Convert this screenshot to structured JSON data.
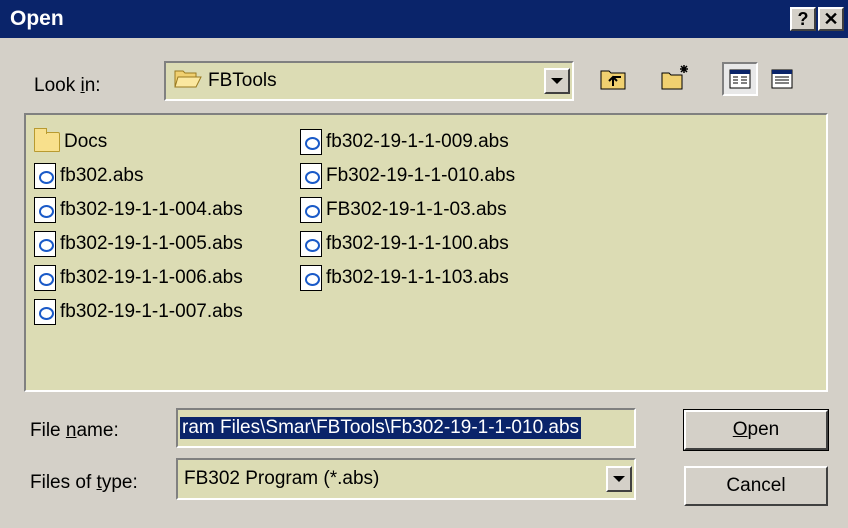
{
  "dialog": {
    "title": "Open",
    "help_btn": "?",
    "close_btn": "✕"
  },
  "look_in": {
    "label_pre": "Look ",
    "label_u": "i",
    "label_post": "n:",
    "value": "FBTools"
  },
  "files": {
    "col1": [
      "Docs",
      "fb302.abs",
      "fb302-19-1-1-004.abs",
      "fb302-19-1-1-005.abs",
      "fb302-19-1-1-006.abs",
      "fb302-19-1-1-007.abs"
    ],
    "col2": [
      "fb302-19-1-1-009.abs",
      "Fb302-19-1-1-010.abs",
      "FB302-19-1-1-03.abs",
      "fb302-19-1-1-100.abs",
      "fb302-19-1-1-103.abs"
    ]
  },
  "file_name": {
    "label_pre": "File ",
    "label_u": "n",
    "label_post": "ame:",
    "value": "ram Files\\Smar\\FBTools\\Fb302-19-1-1-010.abs"
  },
  "file_type": {
    "label_pre": "Files of ",
    "label_u": "t",
    "label_post": "ype:",
    "value": "FB302 Program (*.abs)"
  },
  "buttons": {
    "open_u": "O",
    "open_rest": "pen",
    "cancel": "Cancel"
  },
  "colors": {
    "titlebar": "#0a246a",
    "list_bg": "#dcdcb4",
    "dialog_bg": "#d4d0c8"
  }
}
